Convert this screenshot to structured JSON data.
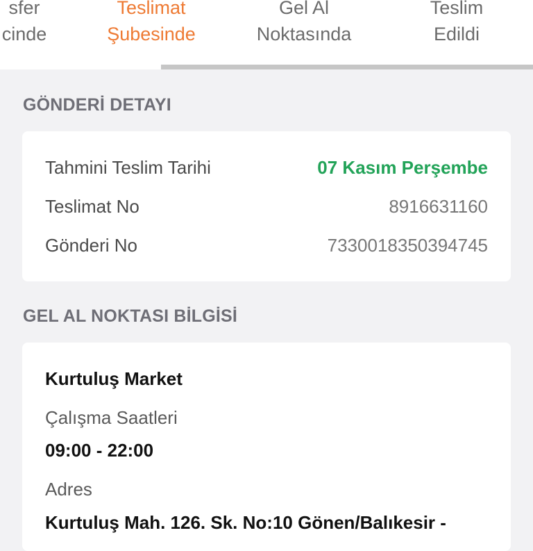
{
  "tabs": [
    {
      "line1": "sfer",
      "line2": "cinde",
      "active": false
    },
    {
      "line1": "Teslimat",
      "line2": "Şubesinde",
      "active": true
    },
    {
      "line1": "Gel Al",
      "line2": "Noktasında",
      "active": false
    },
    {
      "line1": "Teslim",
      "line2": "Edildi",
      "active": false
    }
  ],
  "colors": {
    "active_tab": "#ee7a33",
    "date_value": "#22a358",
    "background": "#f2f2f4"
  },
  "shipment": {
    "title": "GÖNDERİ DETAYI",
    "rows": [
      {
        "label": "Tahmini Teslim Tarihi",
        "value": "07 Kasım Perşembe"
      },
      {
        "label": "Teslimat No",
        "value": "8916631160"
      },
      {
        "label": "Gönderi No",
        "value": "7330018350394745"
      }
    ]
  },
  "pickup_point": {
    "title": "GEL AL NOKTASI BİLGİSİ",
    "name": "Kurtuluş Market",
    "hours_label": "Çalışma Saatleri",
    "hours_value": "09:00 - 22:00",
    "address_label": "Adres",
    "address_value": "Kurtuluş Mah. 126. Sk. No:10 Gönen/Balıkesir -"
  }
}
